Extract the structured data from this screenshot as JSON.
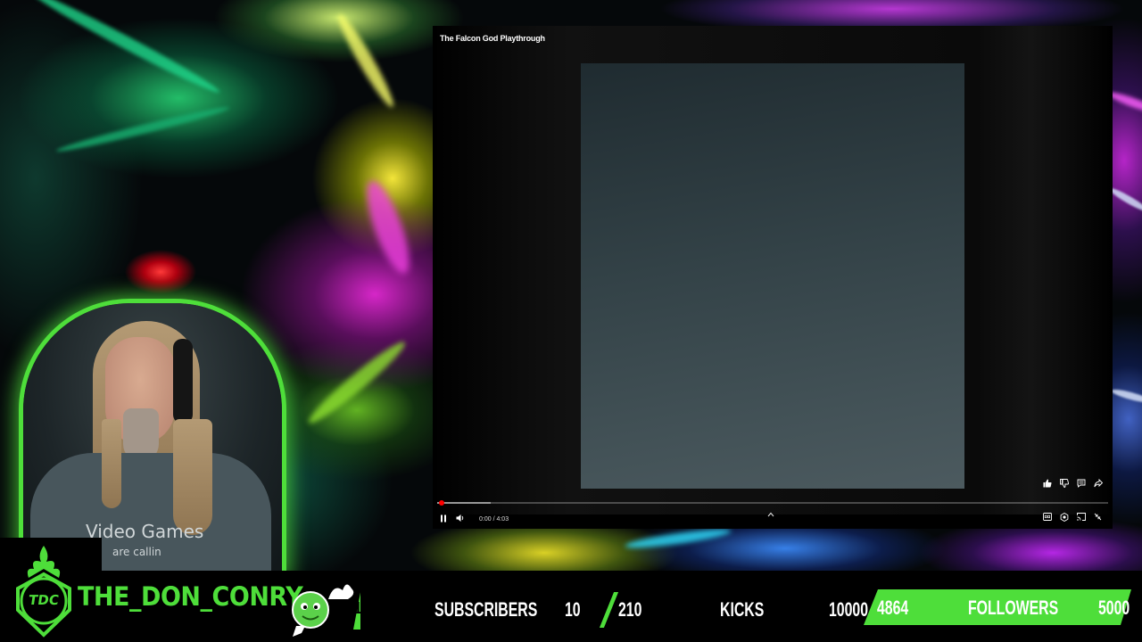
{
  "player": {
    "video_title": "The Falcon God Playthrough",
    "time_display": "0:00 / 4:03",
    "progress": {
      "played_fraction": 0.0,
      "buffered_fraction": 0.08
    },
    "action_icons": [
      "thumbs-up-icon",
      "thumbs-down-icon",
      "comments-icon",
      "share-icon"
    ],
    "control_icons": [
      "pause-icon",
      "volume-icon",
      "chevron-up-icon",
      "captions-icon",
      "settings-icon",
      "cast-icon",
      "exit-fullscreen-icon"
    ]
  },
  "webcam": {
    "shirt_line1": "Video Games",
    "shirt_line2": "are callin",
    "border_color": "#4ede3a"
  },
  "overlay": {
    "logo_text": "TDC",
    "username": "THE_DON_CONRY",
    "emote_count": "1",
    "subscribers_label": "SUBSCRIBERS",
    "subscribers_count": "10",
    "subscribers_goal": "210",
    "kicks_label": "KICKS",
    "kicks_goal": "10000",
    "followers_count": "4864",
    "followers_label": "FOLLOWERS",
    "followers_goal": "5000",
    "accent_color": "#4ede3a"
  }
}
